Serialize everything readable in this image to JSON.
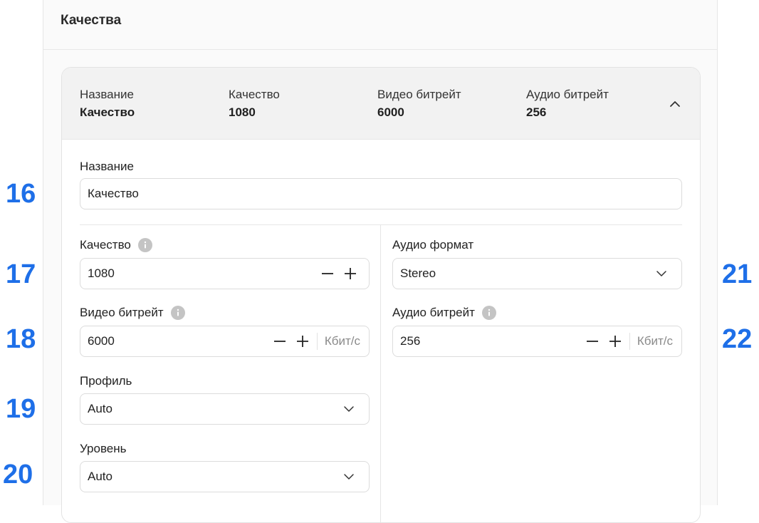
{
  "panel": {
    "title": "Качества"
  },
  "summary": {
    "name": {
      "label": "Название",
      "value": "Качество"
    },
    "quality": {
      "label": "Качество",
      "value": "1080"
    },
    "video_bitrate": {
      "label": "Видео битрейт",
      "value": "6000"
    },
    "audio_bitrate": {
      "label": "Аудио битрейт",
      "value": "256"
    },
    "collapse_icon": "chevron-up-icon"
  },
  "form": {
    "name": {
      "label": "Название",
      "value": "Качество"
    },
    "quality": {
      "label": "Качество",
      "value": "1080"
    },
    "video_bitrate": {
      "label": "Видео битрейт",
      "value": "6000",
      "unit": "Кбит/с"
    },
    "profile": {
      "label": "Профиль",
      "value": "Auto"
    },
    "level": {
      "label": "Уровень",
      "value": "Auto"
    },
    "audio_format": {
      "label": "Аудио формат",
      "value": "Stereo"
    },
    "audio_bitrate": {
      "label": "Аудио битрейт",
      "value": "256",
      "unit": "Кбит/с"
    }
  },
  "annotations": {
    "n16": "16",
    "n17": "17",
    "n18": "18",
    "n19": "19",
    "n20": "20",
    "n21": "21",
    "n22": "22"
  },
  "colors": {
    "annotation": "#1e6fe8",
    "panel_bg": "#fafafa",
    "summary_bg": "#f2f2f2",
    "border": "#dcdcdc"
  }
}
